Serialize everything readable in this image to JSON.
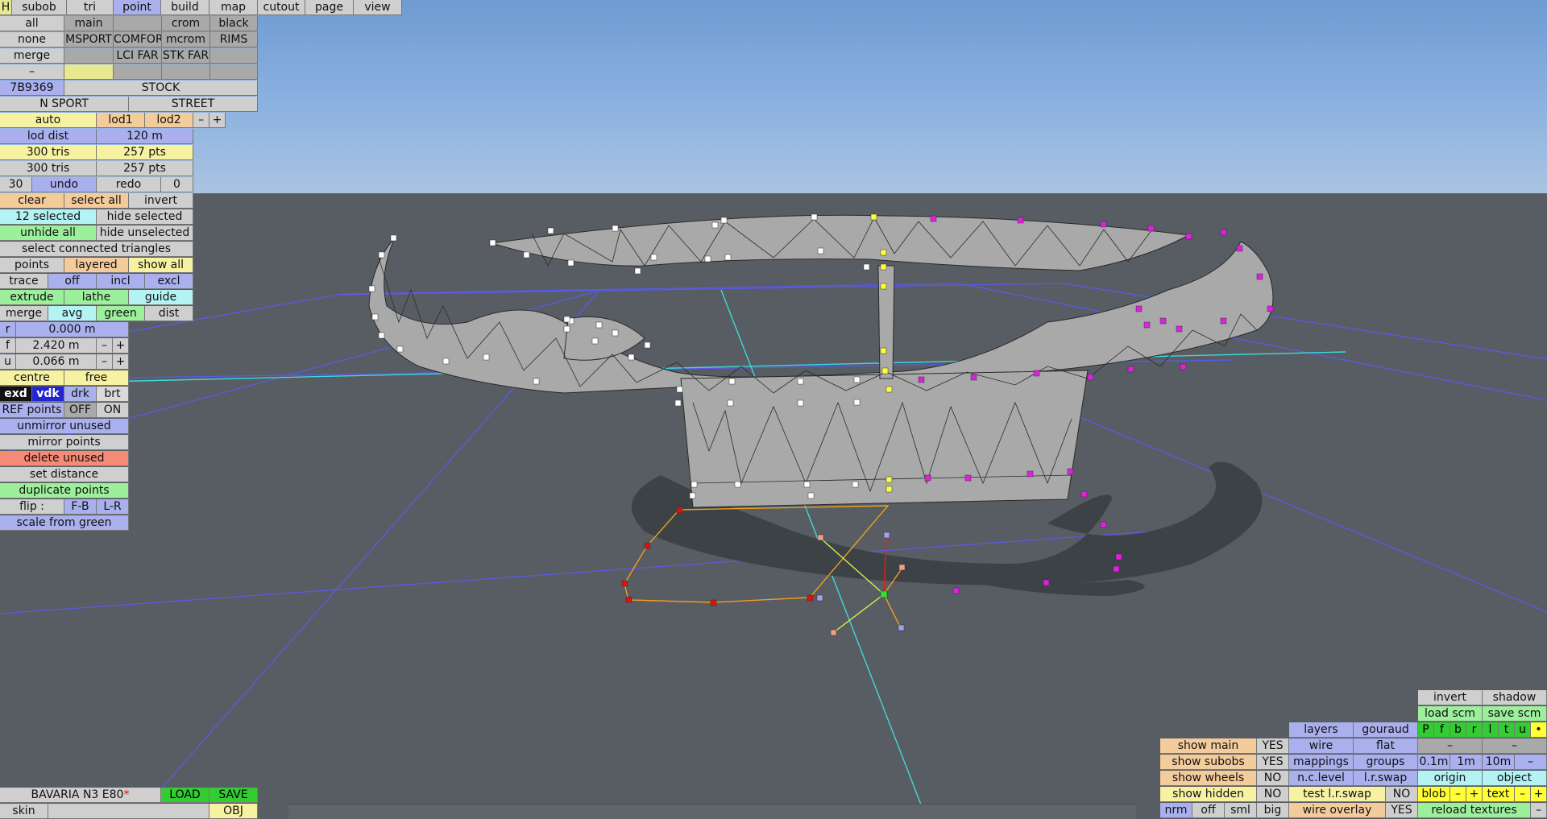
{
  "colors": {
    "sky": "#8cb2e0",
    "ground": "#575d62",
    "mesh": "#a8a8a8",
    "selected_point": "#ffff33",
    "magenta_point": "#e020e0",
    "red_point": "#dd1111",
    "white_point": "#ffffff",
    "grid_line": "#5a5ae6",
    "axis_line": "#40d8d8"
  },
  "tabs": {
    "h": "H",
    "subob": "subob",
    "tri": "tri",
    "point": "point",
    "build": "build",
    "map": "map",
    "cutout": "cutout",
    "page": "page",
    "view": "view"
  },
  "subob_grid": {
    "all": "all",
    "main": "main",
    "crom": "crom",
    "black": "black",
    "none": "none",
    "msport": "MSPORT",
    "comfort": "COMFORT",
    "mcrom": "mcrom",
    "rims": "RIMS",
    "merge": "merge",
    "lci_far": "LCI FAR",
    "stk_far": "STK FAR",
    "dash": "–"
  },
  "variant": {
    "code": "7B9369",
    "stock": "STOCK",
    "n_sport": "N SPORT",
    "street": "STREET"
  },
  "lod": {
    "auto": "auto",
    "lod1": "lod1",
    "lod2": "lod2",
    "minus": "–",
    "plus": "+",
    "dist_label": "lod dist",
    "dist_value": "120 m"
  },
  "stats": {
    "tris1": "300 tris",
    "pts1": "257 pts",
    "tris2": "300 tris",
    "pts2": "257 pts"
  },
  "undo": {
    "count": "30",
    "undo": "undo",
    "redo": "redo",
    "redo_count": "0"
  },
  "selection": {
    "clear": "clear",
    "select_all": "select all",
    "invert": "invert",
    "selected": "12 selected",
    "hide_selected": "hide selected",
    "unhide_all": "unhide all",
    "hide_unselected": "hide unselected",
    "select_connected": "select connected triangles"
  },
  "modes": {
    "points": "points",
    "layered": "layered",
    "show_all": "show all",
    "trace": "trace",
    "off": "off",
    "incl": "incl",
    "excl": "excl",
    "extrude": "extrude",
    "lathe": "lathe",
    "guide": "guide",
    "merge": "merge",
    "avg": "avg",
    "green": "green",
    "dist": "dist"
  },
  "coords": {
    "r_label": "r",
    "r_value": "0.000 m",
    "f_label": "f",
    "f_value": "2.420 m",
    "u_label": "u",
    "u_value": "0.066 m",
    "minus": "–",
    "plus": "+"
  },
  "pivot": {
    "centre": "centre",
    "free": "free"
  },
  "shade": {
    "exd": "exd",
    "vdk": "vdk",
    "drk": "drk",
    "brt": "brt"
  },
  "ref_points": {
    "label": "REF points",
    "off": "OFF",
    "on": "ON"
  },
  "point_ops": {
    "unmirror": "unmirror unused",
    "mirror": "mirror points",
    "delete": "delete unused",
    "set_distance": "set distance",
    "duplicate": "duplicate points",
    "flip": "flip :",
    "fb": "F-B",
    "lr": "L-R",
    "scale": "scale from green"
  },
  "file": {
    "name": "BAVARIA N3 E80",
    "modified": "*",
    "load": "LOAD",
    "save": "SAVE",
    "skin": "skin",
    "obj": "OBJ"
  },
  "right_panel": {
    "invert": "invert",
    "shadow": "shadow",
    "load_scm": "load scm",
    "save_scm": "save scm",
    "channels": [
      "P",
      "f",
      "b",
      "r",
      "l",
      "t",
      "u",
      "•"
    ],
    "layers": "layers",
    "gouraud": "gouraud",
    "wire": "wire",
    "flat": "flat",
    "mappings": "mappings",
    "groups": "groups",
    "n_c_level": "n.c.level",
    "l_r_swap": "l.r.swap",
    "test_l_r_swap": "test l.r.swap",
    "wire_overlay": "wire overlay",
    "dash": "–",
    "grid_01": "0.1m",
    "grid_1": "1m",
    "grid_10": "10m",
    "origin": "origin",
    "object": "object",
    "blob": "blob",
    "text": "text",
    "minus": "–",
    "plus": "+",
    "reload_textures": "reload textures",
    "nrm": "nrm",
    "off": "off",
    "sml": "sml",
    "big": "big",
    "show_main": "show main",
    "show_main_val": "YES",
    "show_subobs": "show subobs",
    "show_subobs_val": "YES",
    "show_wheels": "show wheels",
    "show_wheels_val": "NO",
    "show_hidden": "show hidden",
    "show_hidden_val": "NO",
    "test_val": "NO",
    "wire_overlay_val": "YES"
  }
}
